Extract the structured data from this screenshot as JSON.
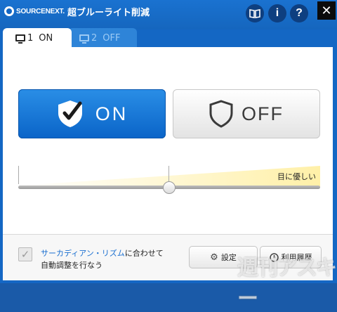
{
  "window": {
    "brand": "SOURCENEXT.",
    "title": "超ブルーライト削減",
    "help_label": "?",
    "info_label": "i",
    "close_label": "✕"
  },
  "tabs": [
    {
      "num": "1",
      "label": "ON",
      "active": true
    },
    {
      "num": "2",
      "label": "OFF",
      "active": false
    }
  ],
  "main": {
    "on_label": "ON",
    "off_label": "OFF",
    "slider_label": "目に優しい",
    "slider_level": 0.5
  },
  "footer": {
    "checkbox_checked": true,
    "checkbox_link": "サーカディアン・リズム",
    "checkbox_text_1": "に合わせて",
    "checkbox_text_2": "自動調整を行なう",
    "settings_label": "設定",
    "history_label": "利用履歴"
  },
  "watermark": "週刊アスキー",
  "colors": {
    "accent": "#1467c4",
    "on_button": "#0a64c8",
    "slider_fill": "#fff3b8"
  }
}
